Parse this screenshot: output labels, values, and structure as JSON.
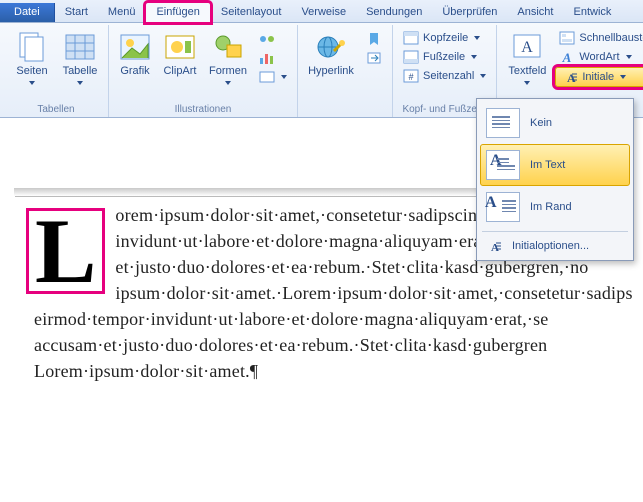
{
  "tabs": {
    "file": "Datei",
    "start": "Start",
    "menu": "Menü",
    "insert": "Einfügen",
    "pagelayout": "Seitenlayout",
    "references": "Verweise",
    "mailings": "Sendungen",
    "review": "Überprüfen",
    "view": "Ansicht",
    "developer": "Entwick"
  },
  "ribbon": {
    "groups": {
      "tables": {
        "label": "Tabellen",
        "pages": "Seiten",
        "table": "Tabelle"
      },
      "illustrations": {
        "label": "Illustrationen",
        "graphic": "Grafik",
        "clipart": "ClipArt",
        "shapes": "Formen"
      },
      "links": {
        "hyperlink": "Hyperlink"
      },
      "headerfooter": {
        "label": "Kopf- und Fußzeile",
        "header": "Kopfzeile",
        "footer": "Fußzeile",
        "pagenum": "Seitenzahl"
      },
      "text": {
        "textfield": "Textfeld",
        "quickparts": "Schnellbausteine",
        "wordart": "WordArt",
        "dropcap": "Initiale"
      }
    }
  },
  "dropdown": {
    "none": "Kein",
    "intext": "Im Text",
    "inmargin": "Im Rand",
    "options": "Initialoptionen..."
  },
  "doc": {
    "dropcap": "L",
    "body": "orem·ipsum·dolor·sit·amet,·consetetur·sadipscing·elitr,·sed·dia invidunt·ut·labore·et·dolore·magna·aliquyam·erat,·sed·diam·vo et·justo·duo·dolores·et·ea·rebum.·Stet·clita·kasd·gubergren,·no ipsum·dolor·sit·amet.·Lorem·ipsum·dolor·sit·amet,·consetetur·sadips eirmod·tempor·invidunt·ut·labore·et·dolore·magna·aliquyam·erat,·se accusam·et·justo·duo·dolores·et·ea·rebum.·Stet·clita·kasd·gubergren Lorem·ipsum·dolor·sit·amet.¶"
  }
}
